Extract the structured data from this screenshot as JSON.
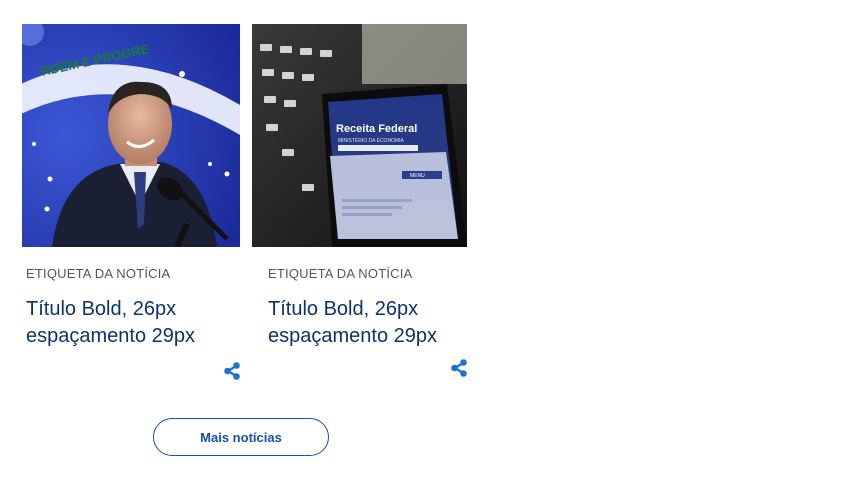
{
  "news_cards": [
    {
      "image_alt": "portrait-photo",
      "tag": "Etiqueta da notícia",
      "title_line1": "Título Bold, 26px",
      "title_line2": "espaçamento 29px",
      "share_icon": "share-icon"
    },
    {
      "image_alt": "receita-federal-phone-photo",
      "image_text_heading": "Receita Federal",
      "image_text_sub": "MINISTÉRIO DA ECONOMIA",
      "image_text_menu": "MENU",
      "tag": "Etiqueta da notícia",
      "title_line1": "Título Bold, 26px",
      "title_line2": "espaçamento 29px",
      "share_icon": "share-icon"
    }
  ],
  "more_button": {
    "label": "Mais notícias"
  },
  "colors": {
    "accent": "#1351b4",
    "title": "#0c326f",
    "tag": "#555555",
    "share": "#1f6fd8"
  }
}
